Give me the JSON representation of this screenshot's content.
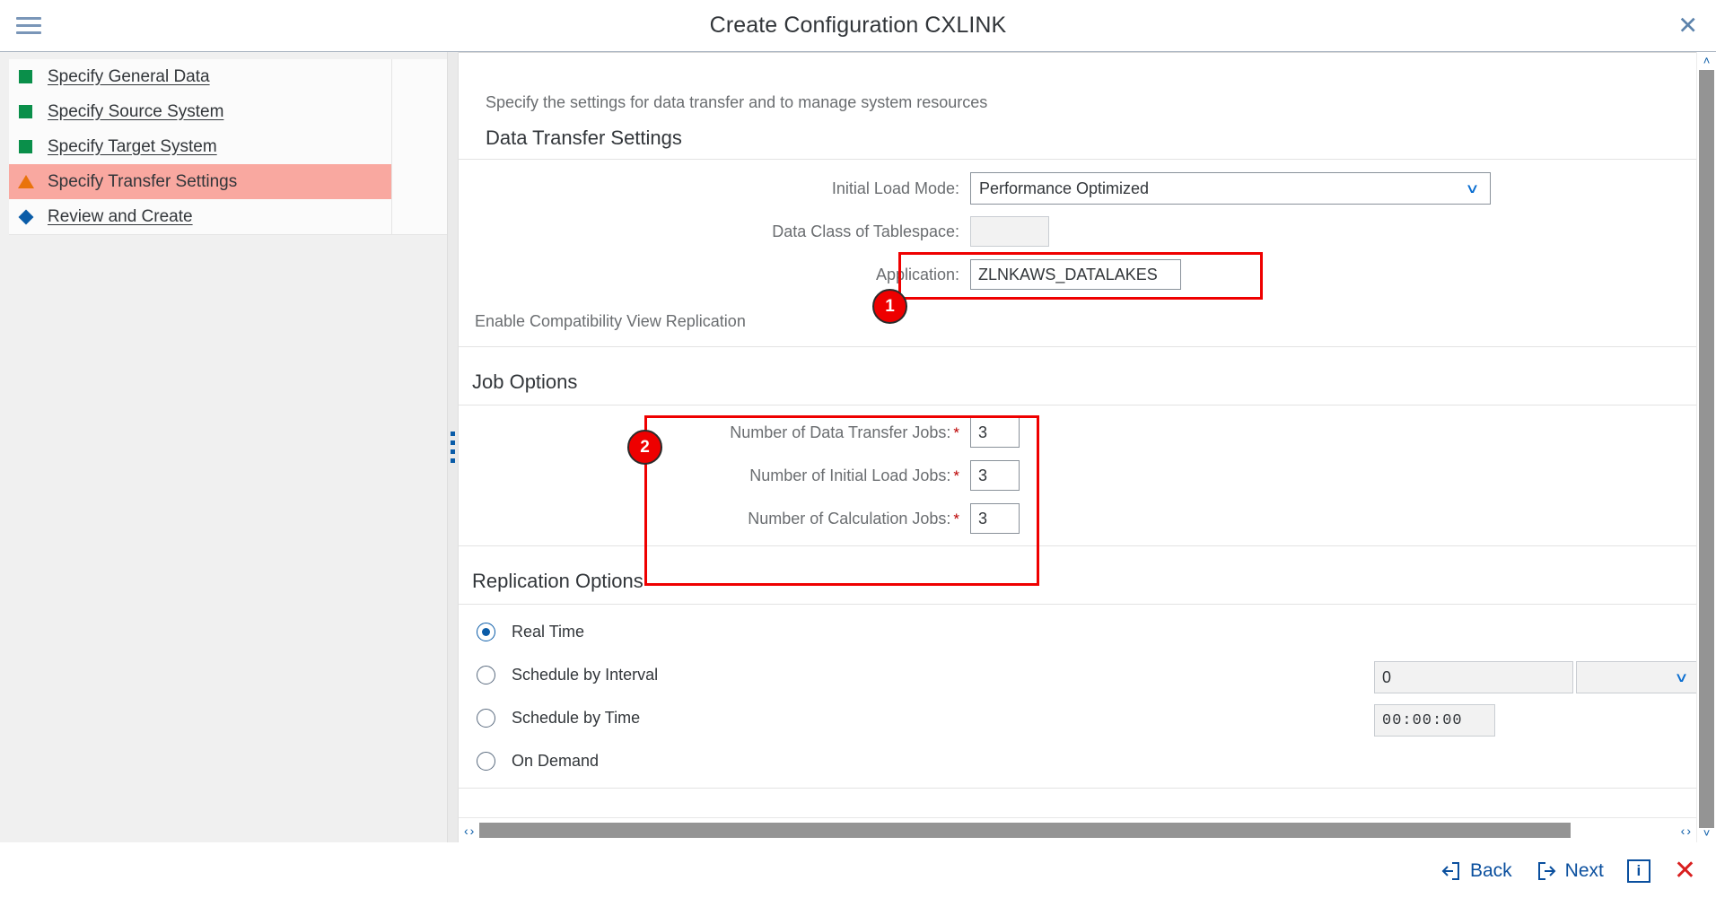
{
  "header": {
    "title": "Create Configuration CXLINK",
    "menu_icon": "hamburger-menu-icon",
    "close_icon": "close-icon",
    "close_label": "✕"
  },
  "sidebar": {
    "items": [
      {
        "label": "Specify General Data",
        "status": "complete",
        "selected": false
      },
      {
        "label": "Specify Source System",
        "status": "complete",
        "selected": false
      },
      {
        "label": "Specify Target System",
        "status": "complete",
        "selected": false
      },
      {
        "label": "Specify Transfer Settings",
        "status": "warning",
        "selected": true
      },
      {
        "label": "Review and Create",
        "status": "pending",
        "selected": false
      }
    ]
  },
  "main": {
    "intro": "Specify the settings for data transfer and to manage system resources",
    "data_transfer": {
      "title": "Data Transfer Settings",
      "initial_load_mode": {
        "label": "Initial Load Mode:",
        "value": "Performance Optimized",
        "chevron": "∨"
      },
      "data_class": {
        "label": "Data Class of Tablespace:",
        "value": ""
      },
      "application": {
        "label": "Application:",
        "value": "ZLNKAWS_DATALAKES"
      },
      "compat_view_label": "Enable Compatibility View Replication"
    },
    "job_options": {
      "title": "Job Options",
      "required_marker": "*",
      "fields": [
        {
          "label": "Number of Data Transfer Jobs:",
          "value": "3",
          "required": true
        },
        {
          "label": "Number of Initial Load Jobs:",
          "value": "3",
          "required": true
        },
        {
          "label": "Number of Calculation Jobs:",
          "value": "3",
          "required": true
        }
      ]
    },
    "replication_options": {
      "title": "Replication Options",
      "options": [
        {
          "label": "Real Time",
          "selected": true
        },
        {
          "label": "Schedule by Interval",
          "selected": false
        },
        {
          "label": "Schedule by Time",
          "selected": false
        },
        {
          "label": "On Demand",
          "selected": false
        }
      ],
      "interval_value": "0",
      "interval_unit": "",
      "interval_unit_chevron": "∨",
      "time_value": "00:00:00"
    }
  },
  "annotations": [
    {
      "number": "1",
      "target": "application-field"
    },
    {
      "number": "2",
      "target": "job-options-group"
    }
  ],
  "scrollbars": {
    "h_left_prev": "‹",
    "h_left_next": "›",
    "h_right_prev": "‹",
    "h_right_next": "›",
    "v_up": "˄",
    "v_down": "˅"
  },
  "footer": {
    "back_label": "Back",
    "next_label": "Next",
    "info_label": "i",
    "close_label": "✕"
  }
}
